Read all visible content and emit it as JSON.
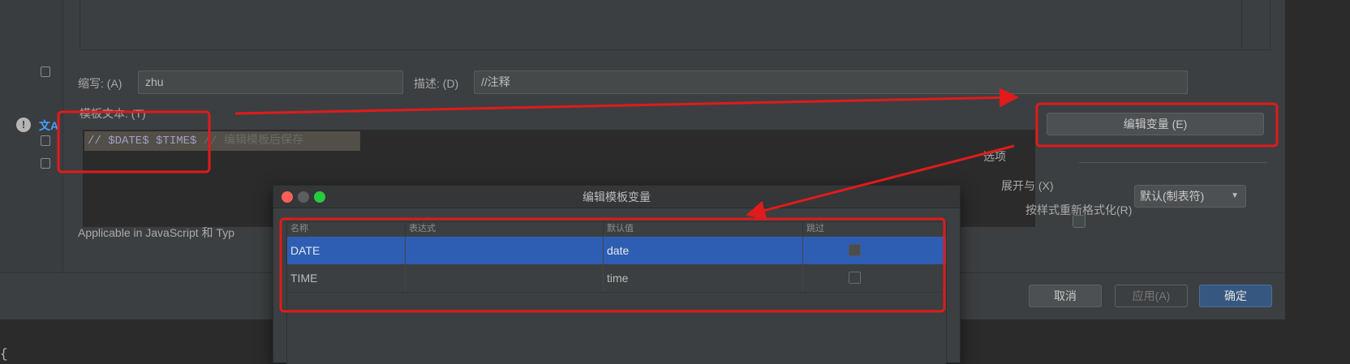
{
  "settings": {
    "abbrev_label": "缩写: (A)",
    "abbrev_value": "zhu",
    "desc_label": "描述: (D)",
    "desc_value": "//注释",
    "template_label": "模板文本: (T)",
    "template_text_main": "// $DATE$ $TIME$",
    "template_text_comment": " // 编辑模板后保存",
    "edit_vars_button": "编辑变量 (E)",
    "options_label": "选项",
    "expand_label": "展开与 (X)",
    "expand_value": "默认(制表符)",
    "reformat_label": "按样式重新格式化(R)",
    "reformat_checked": false,
    "applicable_text": "Applicable in JavaScript 和 Typ",
    "cancel_button": "取消",
    "apply_button": "应用(A)",
    "ok_button": "确定"
  },
  "editor": {
    "brace": "{"
  },
  "vars_dialog": {
    "title": "编辑模板变量",
    "columns": [
      "名称",
      "表达式",
      "默认值",
      "跳过"
    ],
    "rows": [
      {
        "name": "DATE",
        "expression": "",
        "default": "date",
        "skip": true,
        "selected": true
      },
      {
        "name": "TIME",
        "expression": "",
        "default": "time",
        "skip": false,
        "selected": false
      }
    ]
  },
  "colors": {
    "dialog_bg": "#3c3f41",
    "selection": "#2d5eb4",
    "primary_button": "#365880",
    "annotation": "#e01b1b",
    "mac_close": "#ff5f57",
    "mac_minimize": "#febc2e",
    "mac_zoom": "#28c840"
  },
  "icons": [
    "copy-icon",
    "info-icon",
    "translate-icon",
    "chevron-down-icon",
    "checkbox-icon"
  ]
}
